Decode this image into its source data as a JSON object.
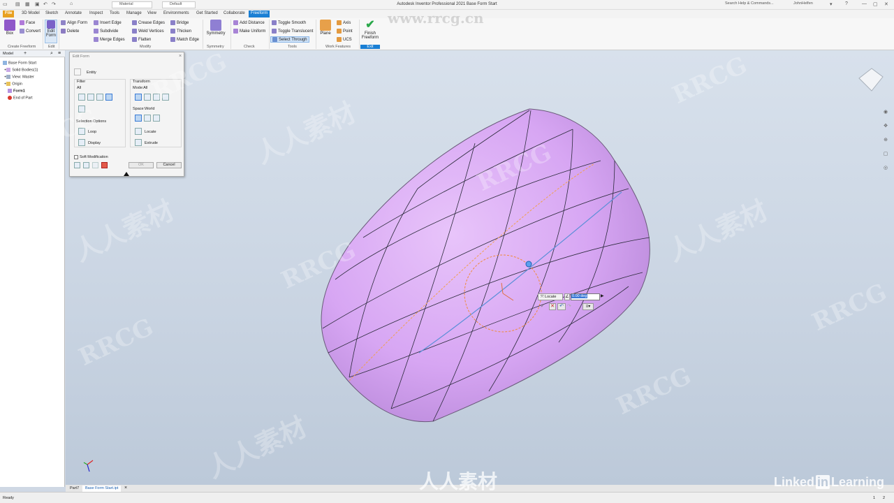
{
  "titlebar": {
    "title": "Autodesk Inventor Professional 2021  Base Form Start",
    "material": "Material",
    "appearance": "Default",
    "search_placeholder": "Search Help & Commands...",
    "user": "JohnHelfen"
  },
  "tabs": [
    "File",
    "3D Model",
    "Sketch",
    "Annotate",
    "Inspect",
    "Tools",
    "Manage",
    "View",
    "Environments",
    "Get Started",
    "Collaborate",
    "Freeform"
  ],
  "active_tab": "Freeform",
  "ribbon": {
    "create": {
      "box": "Box",
      "face": "Face",
      "convert": "Convert",
      "group": "Create Freeform"
    },
    "edit": {
      "edit_form_1": "Edit",
      "edit_form_2": "Form",
      "group": "Edit"
    },
    "modify": {
      "align_form": "Align Form",
      "delete": "Delete",
      "insert_edge": "Insert Edge",
      "subdivide": "Subdivide",
      "merge_edges": "Merge Edges",
      "crease_edges": "Crease Edges",
      "weld_vertices": "Weld Vertices",
      "flatten": "Flatten",
      "bridge": "Bridge",
      "thicken": "Thicken",
      "match_edge": "Match Edge",
      "group": "Modify"
    },
    "symmetry": {
      "symmetry": "Symmetry",
      "group": "Symmetry"
    },
    "check": {
      "add_distance": "Add Distance",
      "make_uniform": "Make Uniform",
      "group": "Check"
    },
    "tools": {
      "toggle_smooth": "Toggle Smooth",
      "toggle_translucent": "Toggle Translucent",
      "select_through": "Select Through",
      "group": "Tools"
    },
    "work_features": {
      "plane": "Plane",
      "axis": "Axis",
      "point": "Point",
      "ucs": "UCS",
      "group": "Work Features"
    },
    "exit": {
      "finish_1": "Finish",
      "finish_2": "Freeform",
      "group": "Exit"
    }
  },
  "browser": {
    "tab": "Model",
    "items": [
      "Base Form Start",
      "Solid Bodies(1)",
      "View: Master",
      "Origin",
      "Form1",
      "End of Part"
    ]
  },
  "dialog": {
    "title": "Edit Form",
    "entity": "Entity",
    "filter": "Filter",
    "filter_all": "All",
    "transform": "Transform",
    "mode": "Mode:All",
    "space": "Space:World",
    "selection_options": "Selection Options",
    "loop": "Loop",
    "display": "Display",
    "locate": "Locate",
    "extrude": "Extrude",
    "soft_modification": "Soft Modification",
    "ok": "OK",
    "cancel": "Cancel"
  },
  "minitoolbar": {
    "locate": "Locate",
    "angle": "0.00 deg"
  },
  "doc_tabs": [
    "Part7",
    "Base Form Start.ipt"
  ],
  "status": {
    "left": "Ready",
    "page_1": "1",
    "page_2": "2"
  },
  "watermarks": {
    "rrcg": "RRCG",
    "cn": "人人素材",
    "url": "www.rrcg.cn",
    "linkedin": "Linked",
    "learning": "Learning",
    "in": "in"
  },
  "colors": {
    "accent": "#1a7fd4",
    "file_tab": "#e8a020",
    "form_fill": "#d7a6f3",
    "edge": "#2a2a3a"
  }
}
